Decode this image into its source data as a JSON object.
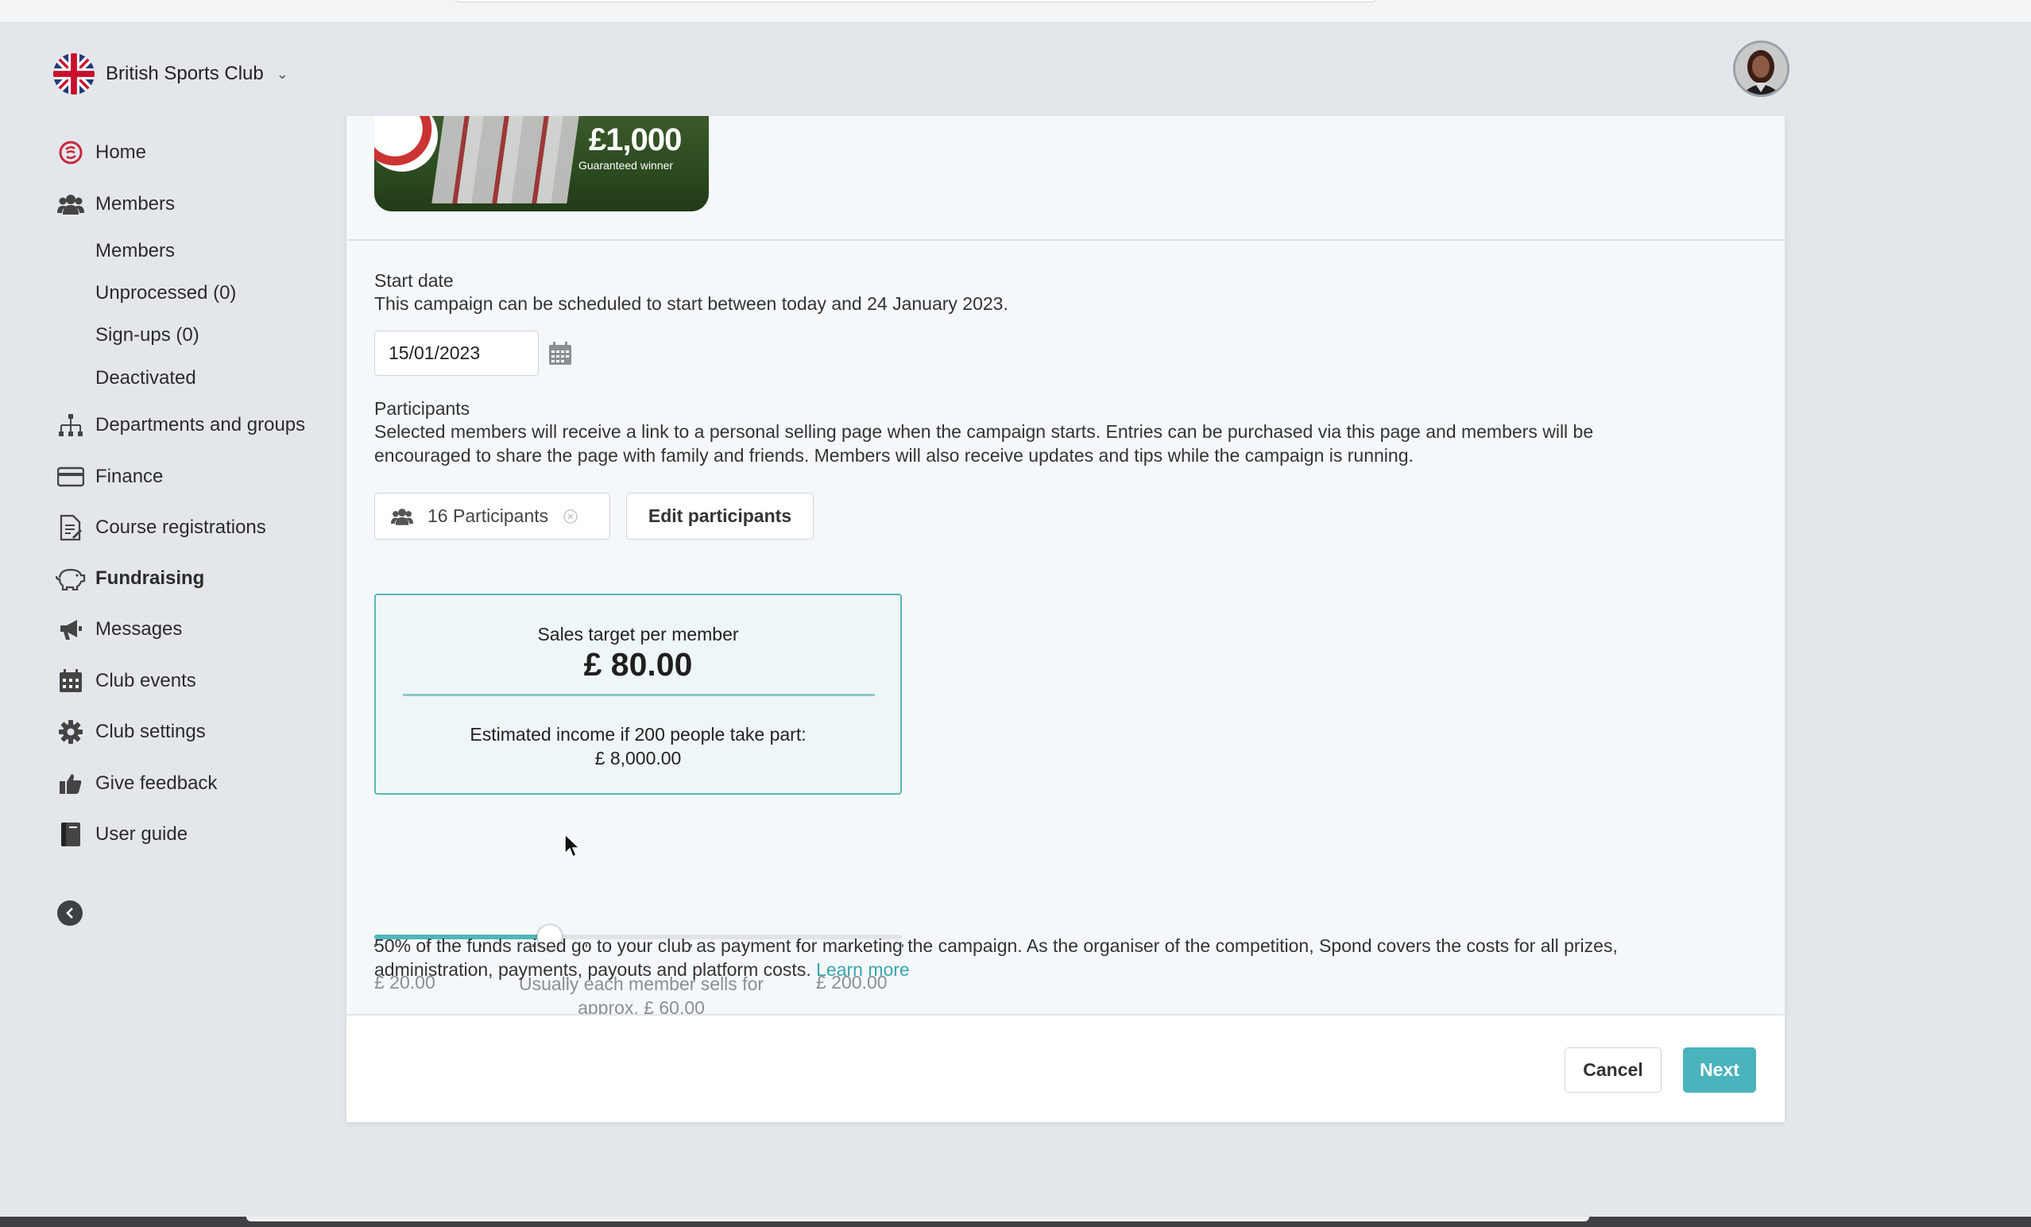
{
  "header": {
    "club_name": "British Sports Club"
  },
  "sidebar": {
    "items": [
      {
        "label": "Home",
        "icon": "spond-logo-icon"
      },
      {
        "label": "Members",
        "icon": "users-icon"
      },
      {
        "label": "Members",
        "icon": null
      },
      {
        "label": "Unprocessed (0)",
        "icon": null
      },
      {
        "label": "Sign-ups (0)",
        "icon": null
      },
      {
        "label": "Deactivated",
        "icon": null
      },
      {
        "label": "Departments and groups",
        "icon": "org-chart-icon"
      },
      {
        "label": "Finance",
        "icon": "credit-card-icon"
      },
      {
        "label": "Course registrations",
        "icon": "document-icon"
      },
      {
        "label": "Fundraising",
        "icon": "piggy-bank-icon"
      },
      {
        "label": "Messages",
        "icon": "megaphone-icon"
      },
      {
        "label": "Club events",
        "icon": "calendar-icon"
      },
      {
        "label": "Club settings",
        "icon": "gear-icon"
      },
      {
        "label": "Give feedback",
        "icon": "thumbs-up-icon"
      },
      {
        "label": "User guide",
        "icon": "book-icon"
      }
    ],
    "active_item": "Fundraising"
  },
  "banner": {
    "amount": "£1,000",
    "subtitle": "Guaranteed winner"
  },
  "start_date": {
    "label": "Start date",
    "description": "This campaign can be scheduled to start between today and 24 January 2023.",
    "value": "15/01/2023"
  },
  "participants": {
    "label": "Participants",
    "description_line1": "Selected members will receive a link to a personal selling page when the campaign starts. Entries can be purchased via this page and members will be",
    "description_line2": "encouraged to share the page with family and friends. Members will also receive updates and tips while the campaign is running.",
    "chip_label": "16 Participants",
    "edit_button": "Edit participants"
  },
  "sales_target": {
    "label": "Sales target per member",
    "value": "£ 80.00",
    "income_label": "Estimated income if 200 people take part:",
    "income_value": "£ 8,000.00"
  },
  "slider": {
    "min_label": "£ 20.00",
    "max_label": "£ 200.00",
    "hint_line1": "Usually each member sells for",
    "hint_line2": "approx. £ 60.00",
    "min": 20,
    "max": 200,
    "value": 80,
    "tick_count": 10
  },
  "info": {
    "line1": "50% of the funds raised go to your club as payment for marketing the campaign. As the organiser of the competition, Spond covers the costs for all prizes,",
    "line2": "administration, payments, payouts and platform costs.",
    "learn_more": "Learn more"
  },
  "footer": {
    "cancel_label": "Cancel",
    "next_label": "Next"
  },
  "colors": {
    "accent": "#4ab3bc",
    "link": "#3aa5ab",
    "target_border": "#5ab5b8"
  }
}
